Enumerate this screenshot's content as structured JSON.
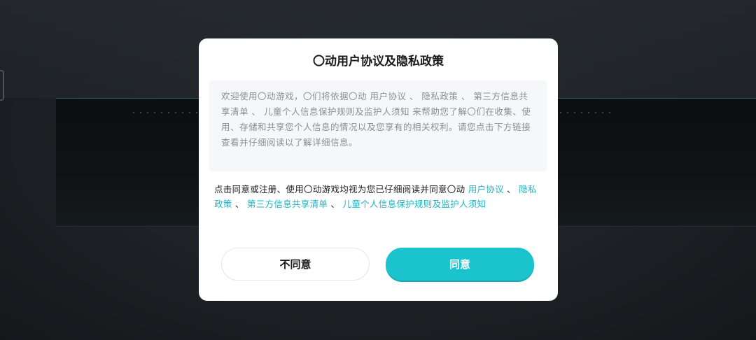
{
  "dialog": {
    "title": "〇动用户协议及隐私政策",
    "notice": "欢迎使用〇动游戏，〇们将依据〇动 用户协议 、 隐私政策 、 第三方信息共享清单 、 儿童个人信息保护规则及监护人须知 来帮助您了解〇们在收集、使用、存储和共享您个人信息的情况以及您享有的相关权利。请您点击下方链接查看并仔细阅读以了解详细信息。",
    "consent_prefix": "点击同意或注册、使用〇动游戏均视为您已仔细阅读并同意〇动 ",
    "links": {
      "user_agreement": "用户协议",
      "privacy_policy": "隐私政策",
      "third_party_list": "第三方信息共享清单",
      "children_rules": "儿童个人信息保护规则及监护人须知"
    },
    "separator": " 、 ",
    "decline_label": "不同意",
    "agree_label": "同意"
  },
  "colors": {
    "accent": "#1bc3cf",
    "link": "#1ab5c7",
    "backdrop": "#1f2327"
  }
}
